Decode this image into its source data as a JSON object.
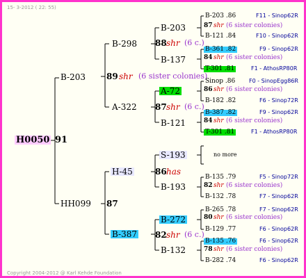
{
  "header": "15- 3-2012 ( 22: 55)",
  "footer": "Copyright 2004-2012 @ Karl Kehde Foundation",
  "root": {
    "id": "H0050",
    "num": "91"
  },
  "gen1": {
    "top": {
      "id": "B-203",
      "num": "89",
      "shr": "shr",
      "sisters": "(6 sister colonies)"
    },
    "bottom": {
      "id": "HH099",
      "num": "87"
    }
  },
  "gen2": {
    "b298": {
      "id": "B-298",
      "num": "88",
      "shr": "shr",
      "sisters": "(6 c.)"
    },
    "a322": {
      "id": "A-322",
      "num": "87",
      "shr": "shr",
      "sisters": "(6 c.)"
    },
    "h45": {
      "id": "H-45",
      "num": "86",
      "shr": "has"
    },
    "b387": {
      "id": "B-387",
      "num": "82",
      "shr": "shr",
      "sisters": "(6 c.)"
    }
  },
  "gen3": {
    "b203": {
      "id": "B-203"
    },
    "b137": {
      "id": "B-137",
      "num": "84",
      "shr": "shr",
      "sisters": "(6 sister colonies)"
    },
    "a72": {
      "id": "A-72",
      "num": "86",
      "shr": "shr",
      "sisters": "(6 sister colonies)"
    },
    "b121": {
      "id": "B-121",
      "num": "84",
      "shr": "shr",
      "sisters": "(6 sister colonies)"
    },
    "s193": {
      "id": "S-193",
      "nomore": "no more"
    },
    "b193": {
      "id": "B-193",
      "num": "82",
      "shr": "shr",
      "sisters": "(6 sister colonies)"
    },
    "b272": {
      "id": "B-272",
      "num": "80",
      "shr": "shr",
      "sisters": "(6 sister colonies)"
    },
    "b132": {
      "id": "B-132",
      "num": "78",
      "shr": "shr",
      "sisters": "(6 sister colonies)"
    }
  },
  "gen3_top": {
    "num": "87",
    "shr": "shr",
    "sisters": "(6 sister colonies)"
  },
  "gen4": [
    {
      "id": "B-203 .86",
      "src": "F11 - Sinop62R"
    },
    {
      "id": "B-121 .84",
      "src": "F10 - Sinop62R"
    },
    {
      "id": "B-361 .82",
      "src": "F9 - Sinop62R"
    },
    {
      "id": "T-301 .81",
      "src": "F1 - AthosRP80R"
    },
    {
      "id": "Sinop .86",
      "src": "F0 - SinopEgg86R"
    },
    {
      "id": "B-182 .82",
      "src": "F6 - Sinop72R"
    },
    {
      "id": "B-387 .82",
      "src": "F9 - Sinop62R"
    },
    {
      "id": "T-301 .81",
      "src": "F1 - AthosRP80R"
    },
    {
      "id": "B-135 .79",
      "src": "F5 - Sinop72R"
    },
    {
      "id": "B-132 .78",
      "src": "F7 - Sinop62R"
    },
    {
      "id": "B-265 .78",
      "src": "F7 - Sinop62R"
    },
    {
      "id": "B-129 .77",
      "src": "F6 - Sinop62R"
    },
    {
      "id": "B-135 .76",
      "src": "F6 - Sinop62R"
    },
    {
      "id": "B-282 .74",
      "src": "F6 - Sinop62R"
    }
  ]
}
